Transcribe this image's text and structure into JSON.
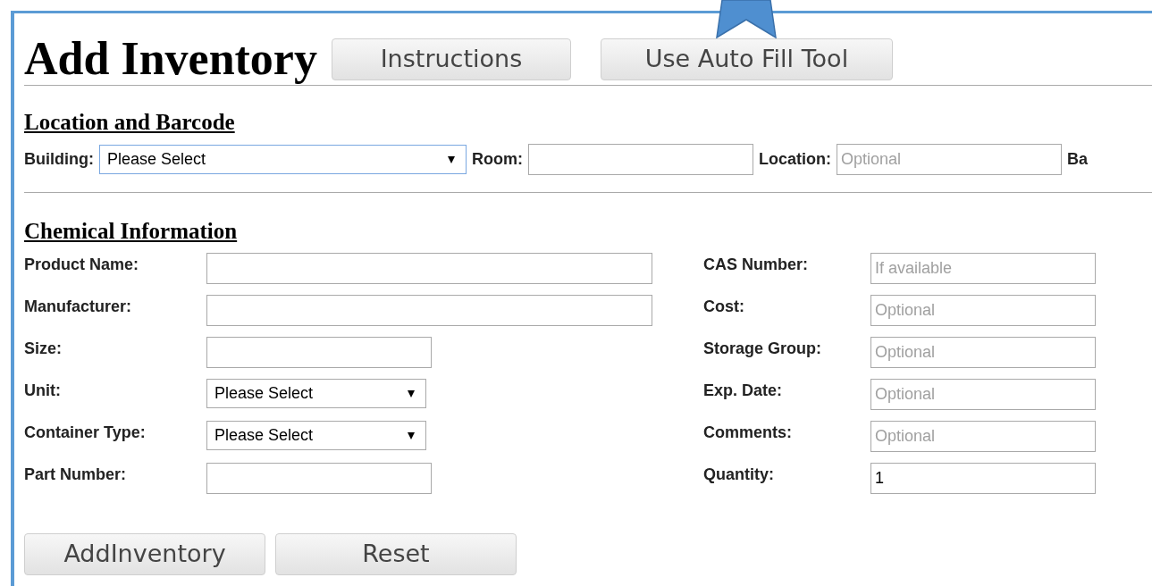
{
  "title": "Add Inventory",
  "header_buttons": [
    "Instructions",
    "Use Auto Fill Tool"
  ],
  "location_section": {
    "heading": "Location and Barcode",
    "fields": [
      {
        "label": "Building:",
        "kind": "select",
        "value": "Please Select",
        "focused": true
      },
      {
        "label": "Room:",
        "kind": "input",
        "focused": false
      },
      {
        "label": "Location:",
        "kind": "input",
        "placeholder": "Optional",
        "focused": false
      },
      {
        "label": "Ba",
        "kind": "cut"
      }
    ]
  },
  "chemical_section": {
    "heading": "Chemical Information",
    "left_fields": [
      {
        "label": "Product Name:",
        "kind": "wide-input"
      },
      {
        "label": "Manufacturer:",
        "kind": "wide-input"
      },
      {
        "label": "Size:",
        "kind": "input"
      },
      {
        "label": "Unit:",
        "kind": "select",
        "value": "Please Select"
      },
      {
        "label": "Container Type:",
        "kind": "select",
        "value": "Please Select"
      },
      {
        "label": "Part Number:",
        "kind": "input"
      }
    ],
    "right_fields": [
      {
        "label": "CAS Number:",
        "kind": "input",
        "placeholder": "If available"
      },
      {
        "label": "Cost:",
        "kind": "input",
        "placeholder": "Optional"
      },
      {
        "label": "Storage Group:",
        "kind": "input",
        "placeholder": "Optional"
      },
      {
        "label": "Exp. Date:",
        "kind": "input",
        "placeholder": "Optional"
      },
      {
        "label": "Comments:",
        "kind": "input",
        "placeholder": "Optional"
      },
      {
        "label": "Quantity:",
        "kind": "input",
        "value": "1"
      }
    ]
  },
  "action_buttons": [
    "AddInventory",
    "Reset"
  ]
}
